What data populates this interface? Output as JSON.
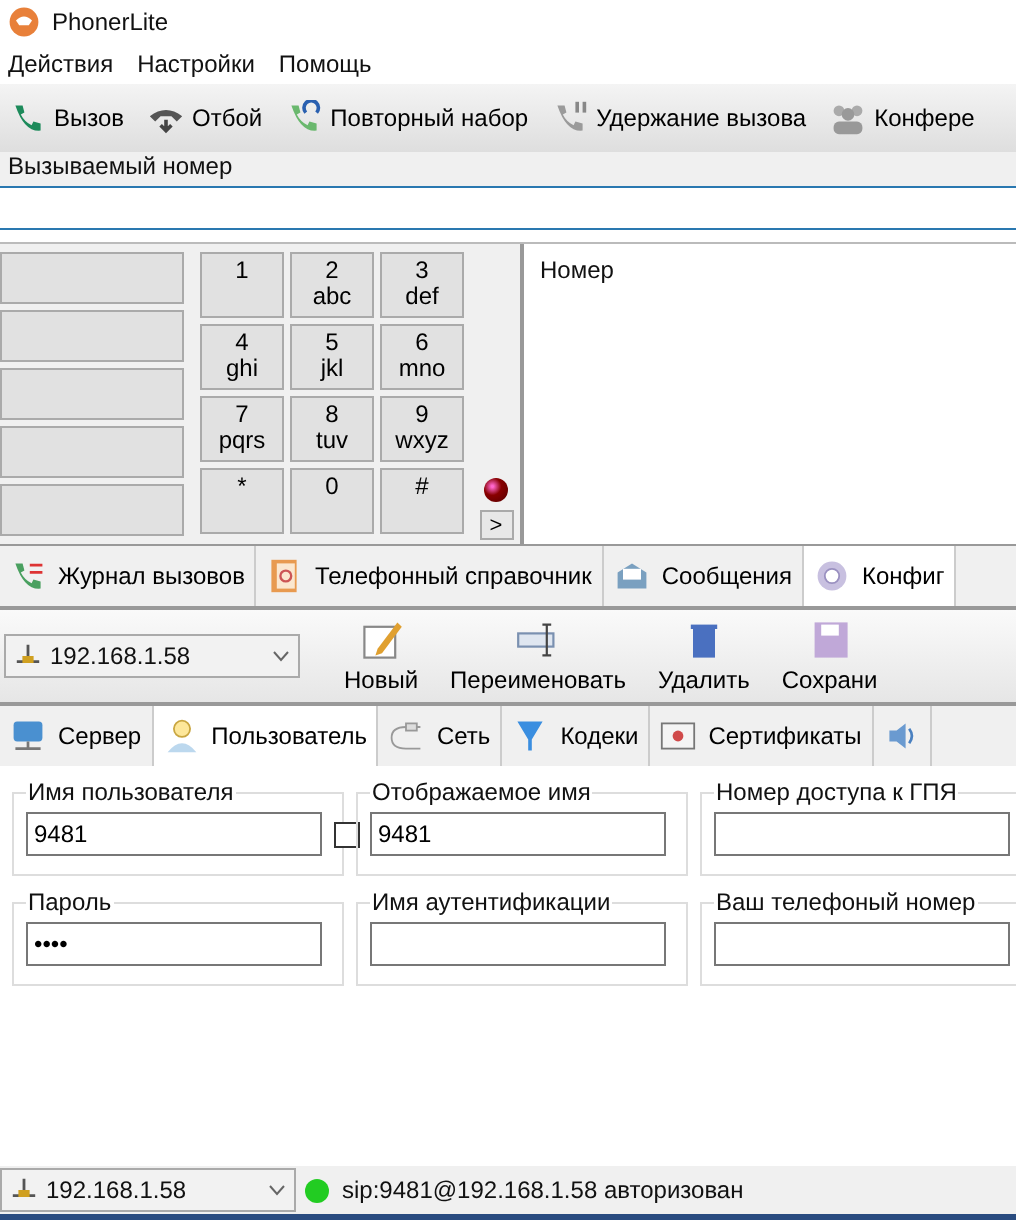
{
  "window": {
    "title": "PhonerLite"
  },
  "menu": [
    "Действия",
    "Настройки",
    "Помощь"
  ],
  "toolbar": [
    {
      "kind": "call",
      "label": "Вызов"
    },
    {
      "kind": "hangup",
      "label": "Отбой"
    },
    {
      "kind": "redial",
      "label": "Повторный набор"
    },
    {
      "kind": "hold",
      "label": "Удержание вызова"
    },
    {
      "kind": "conference",
      "label": "Конфере"
    }
  ],
  "dial": {
    "label": "Вызываемый номер"
  },
  "keypad": [
    {
      "digit": "1"
    },
    {
      "digit": "2",
      "letters": "abc"
    },
    {
      "digit": "3",
      "letters": "def"
    },
    {
      "digit": "4",
      "letters": "ghi"
    },
    {
      "digit": "5",
      "letters": "jkl"
    },
    {
      "digit": "6",
      "letters": "mno"
    },
    {
      "digit": "7",
      "letters": "pqrs"
    },
    {
      "digit": "8",
      "letters": "tuv"
    },
    {
      "digit": "9",
      "letters": "wxyz"
    },
    {
      "digit": "*"
    },
    {
      "digit": "0"
    },
    {
      "digit": "#"
    }
  ],
  "led_on": false,
  "expand_button": ">",
  "number_panel": {
    "header": "Номер"
  },
  "tabs": [
    {
      "kind": "journal",
      "label": "Журнал вызовов",
      "selected": false
    },
    {
      "kind": "phonebook",
      "label": "Телефонный справочник",
      "selected": false
    },
    {
      "kind": "messages",
      "label": "Сообщения",
      "selected": false
    },
    {
      "kind": "config",
      "label": "Конфиг",
      "selected": true
    }
  ],
  "config_toolbar": {
    "account": "192.168.1.58",
    "buttons": [
      {
        "kind": "new",
        "label": "Новый"
      },
      {
        "kind": "rename",
        "label": "Переименовать"
      },
      {
        "kind": "delete",
        "label": "Удалить"
      },
      {
        "kind": "save",
        "label": "Сохрани"
      }
    ]
  },
  "sub_tabs": [
    {
      "kind": "server",
      "label": "Сервер",
      "selected": false
    },
    {
      "kind": "user",
      "label": "Пользователь",
      "selected": true
    },
    {
      "kind": "network",
      "label": "Сеть",
      "selected": false
    },
    {
      "kind": "codecs",
      "label": "Кодеки",
      "selected": false
    },
    {
      "kind": "certs",
      "label": "Сертификаты",
      "selected": false
    },
    {
      "kind": "audio",
      "selected": false
    }
  ],
  "fields": [
    {
      "label": "Имя пользователя",
      "value": "9481",
      "checked": false
    },
    {
      "label": "Отображаемое имя",
      "value": "9481"
    },
    {
      "label": "Номер доступа к ГПЯ"
    },
    {
      "label": "Пароль",
      "value": "••••"
    },
    {
      "label": "Имя аутентификации"
    },
    {
      "label": "Ваш телефоный номер"
    }
  ],
  "status_bar": {
    "account": "192.168.1.58",
    "registered": true,
    "text": "sip:9481@192.168.1.58 авторизован"
  }
}
